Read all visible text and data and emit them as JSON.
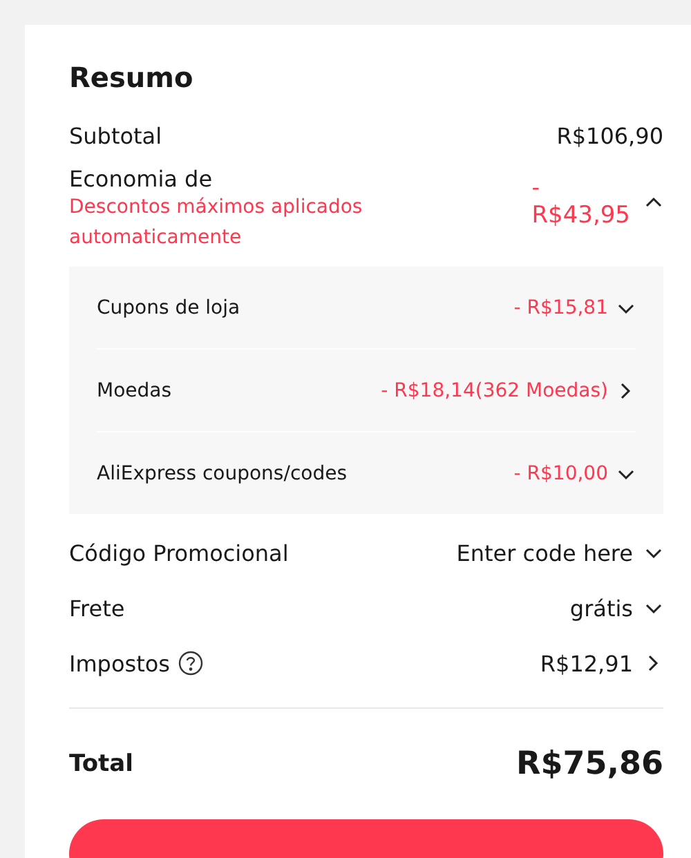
{
  "title": "Resumo",
  "subtotal": {
    "label": "Subtotal",
    "value": "R$106,90"
  },
  "savings": {
    "label": "Economia de",
    "note": "Descontos máximos aplicados automaticamente",
    "sign": "-",
    "value": "R$43,95",
    "expanded": true,
    "items": [
      {
        "label": "Cupons de loja",
        "value": "- R$15,81",
        "kind": "dropdown"
      },
      {
        "label": "Moedas",
        "value": "- R$18,14(362 Moedas)",
        "kind": "link"
      },
      {
        "label": "AliExpress coupons/codes",
        "value": "- R$10,00",
        "kind": "dropdown"
      }
    ]
  },
  "rows": [
    {
      "label": "Código Promocional",
      "value": "Enter code here",
      "kind": "dropdown",
      "info": false
    },
    {
      "label": "Frete",
      "value": "grátis",
      "kind": "dropdown",
      "info": false
    },
    {
      "label": "Impostos",
      "value": "R$12,91",
      "kind": "link",
      "info": true
    }
  ],
  "total": {
    "label": "Total",
    "value": "R$75,86"
  }
}
